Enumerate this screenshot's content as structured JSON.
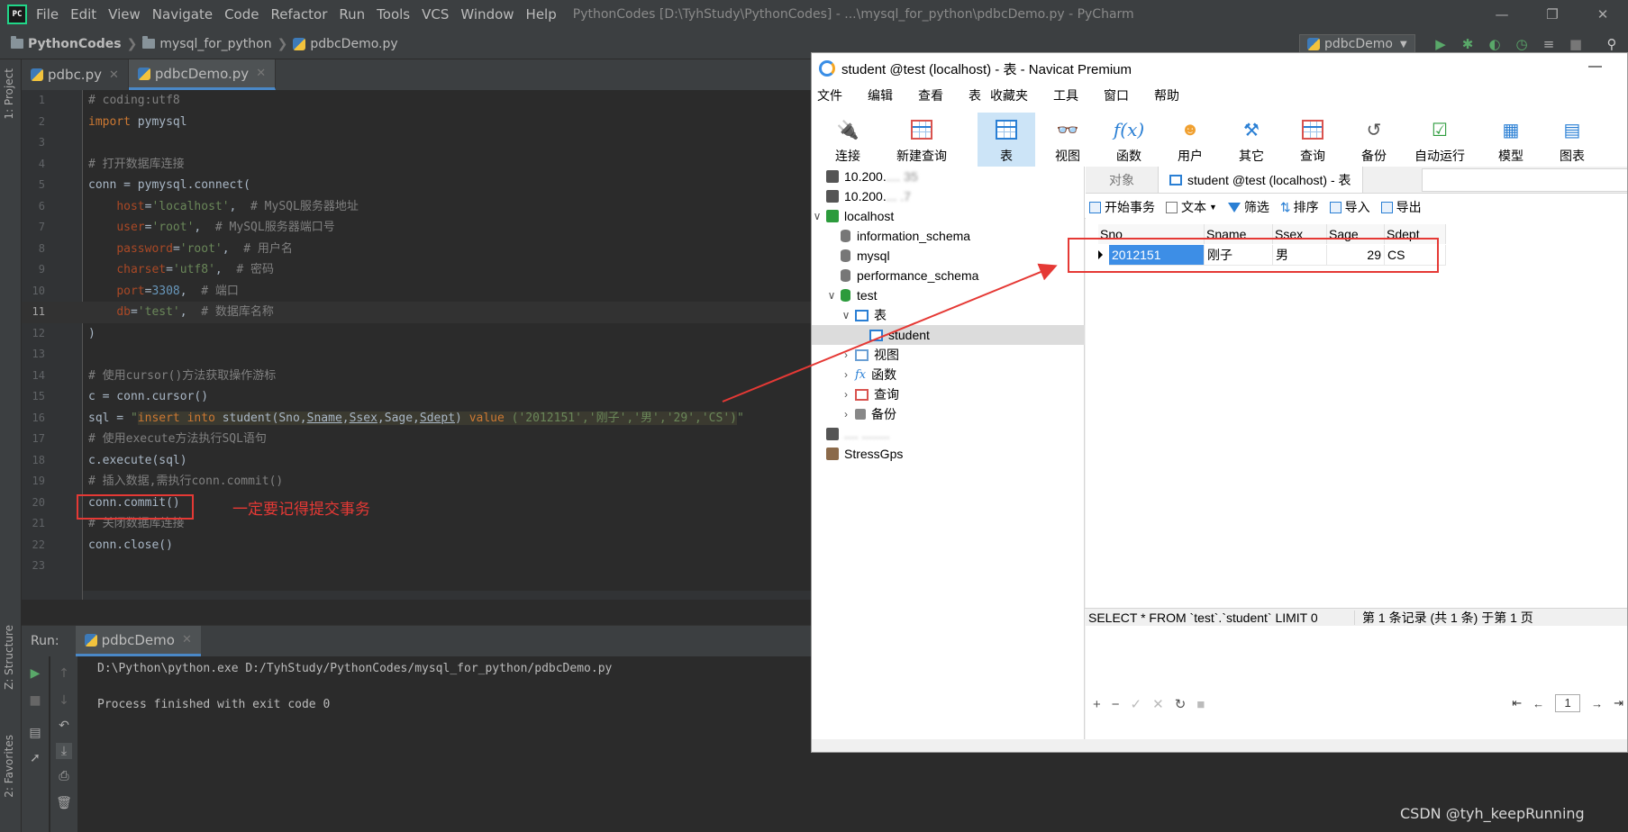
{
  "pycharm": {
    "logo": "PC",
    "menu": [
      "File",
      "Edit",
      "View",
      "Navigate",
      "Code",
      "Refactor",
      "Run",
      "Tools",
      "VCS",
      "Window",
      "Help"
    ],
    "title": "PythonCodes [D:\\TyhStudy\\PythonCodes] - ...\\mysql_for_python\\pdbcDemo.py - PyCharm",
    "breadcrumb": [
      "PythonCodes",
      "mysql_for_python",
      "pdbcDemo.py"
    ],
    "run_config": "pdbcDemo",
    "left_tools": [
      "1: Project",
      "Z: Structure",
      "2: Favorites"
    ],
    "tabs": [
      "pdbc.py",
      "pdbcDemo.py"
    ],
    "code_text": {
      "l1": "# coding:utf8",
      "l2_kw": "import",
      "l2_rest": " pymysql",
      "l4": "# 打开数据库连接",
      "l5": "conn = pymysql.connect(",
      "l6_k": "host",
      "l6_v": "'localhost'",
      "l6_c": "# MySQL服务器地址",
      "l7_k": "user",
      "l7_v": "'root'",
      "l7_c": "# MySQL服务器端口号",
      "l8_k": "password",
      "l8_v": "'root'",
      "l8_c": "# 用户名",
      "l9_k": "charset",
      "l9_v": "'utf8'",
      "l9_c": "# 密码",
      "l10_k": "port",
      "l10_v": "3308",
      "l10_c": "# 端口",
      "l11_k": "db",
      "l11_v": "'test'",
      "l11_c": "# 数据库名称",
      "l12": ")",
      "l14": "# 使用cursor()方法获取操作游标",
      "l15": "c = conn.cursor()",
      "l16_a": "sql = ",
      "l16_q": "\"",
      "l16_ins": "insert into",
      "l16_tbl": " student(Sno,",
      "l16_sname": "Sname",
      "l16_c1": ",",
      "l16_ssex": "Ssex",
      "l16_c2": ",Sage,",
      "l16_sdept": "Sdept",
      "l16_c3": ") ",
      "l16_val": "value",
      "l16_lit": " ('2012151','刚子','男','29','CS')",
      "l16_end": "\"",
      "l17": "# 使用execute方法执行SQL语句",
      "l18": "c.execute(sql)",
      "l19": "# 插入数据,需执行conn.commit()",
      "l20": "conn.commit()",
      "l21": "# 关闭数据库连接",
      "l22": "conn.close()"
    },
    "line_numbers": [
      "1",
      "2",
      "3",
      "4",
      "5",
      "6",
      "7",
      "8",
      "9",
      "10",
      "11",
      "12",
      "13",
      "14",
      "15",
      "16",
      "17",
      "18",
      "19",
      "20",
      "21",
      "22",
      "23"
    ],
    "run": {
      "label": "Run:",
      "tab": "pdbcDemo",
      "cmd": "D:\\Python\\python.exe D:/TyhStudy/PythonCodes/mysql_for_python/pdbcDemo.py",
      "exit": "Process finished with exit code 0"
    }
  },
  "annotation": "一定要记得提交事务",
  "watermark": "CSDN @tyh_keepRunning",
  "navicat": {
    "title": "student @test (localhost) - 表 - Navicat Premium",
    "menu": [
      "文件",
      "编辑",
      "查看",
      "表",
      "收藏夹",
      "工具",
      "窗口",
      "帮助"
    ],
    "toolbar": [
      "连接",
      "新建查询",
      "表",
      "视图",
      "函数",
      "用户",
      "其它",
      "查询",
      "备份",
      "自动运行",
      "模型",
      "图表"
    ],
    "tree": {
      "conn1": "10.200.",
      "conn2": "10.200.",
      "localhost": "localhost",
      "dbs": [
        "information_schema",
        "mysql",
        "performance_schema"
      ],
      "test": "test",
      "tables_node": "表",
      "student": "student",
      "views": "视图",
      "funcs": "函数",
      "queries": "查询",
      "backups": "备份",
      "stress": "StressGps"
    },
    "tabs": {
      "objects": "对象",
      "active": "student @test (localhost) - 表"
    },
    "subtools": [
      "开始事务",
      "文本",
      "筛选",
      "排序",
      "导入",
      "导出"
    ],
    "grid": {
      "headers": [
        "Sno",
        "Sname",
        "Ssex",
        "Sage",
        "Sdept"
      ],
      "row": [
        "2012151",
        "刚子",
        "男",
        "29",
        "CS"
      ]
    },
    "page_num": "1",
    "status_sql": "SELECT * FROM `test`.`student` LIMIT 0",
    "status_rec": "第 1 条记录 (共 1 条) 于第 1 页"
  }
}
